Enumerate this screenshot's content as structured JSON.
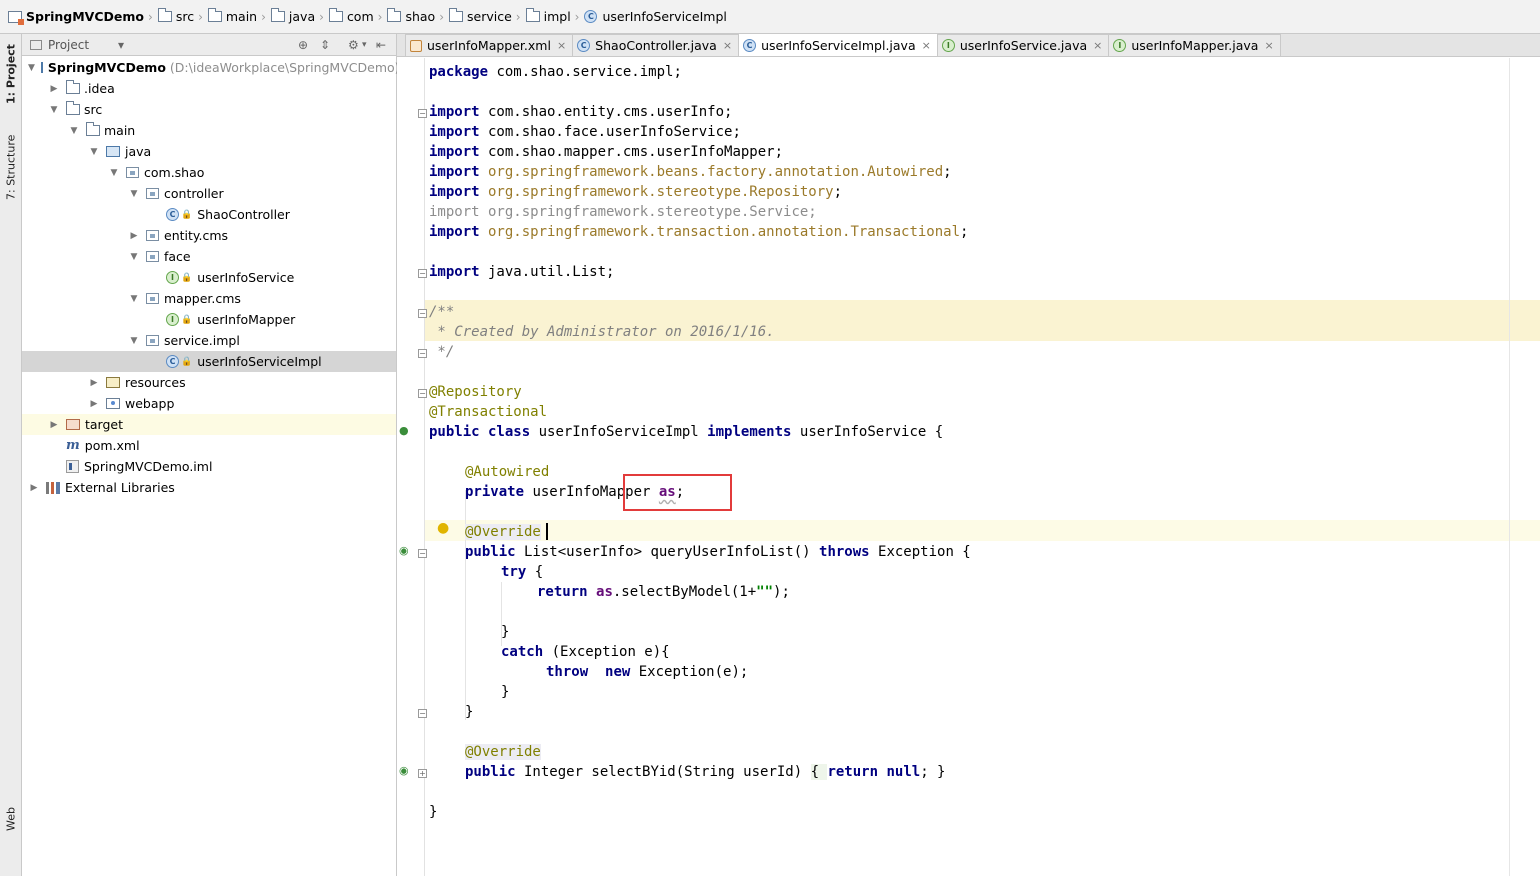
{
  "breadcrumb": [
    "SpringMVCDemo",
    "src",
    "main",
    "java",
    "com",
    "shao",
    "service",
    "impl",
    "userInfoServiceImpl"
  ],
  "left_strip": {
    "project_tab": "1: Project",
    "structure_tab": "7: Structure",
    "web_tab": "Web"
  },
  "project_panel": {
    "title": "Project",
    "tree": [
      {
        "label": "SpringMVCDemo",
        "path": "(D:\\ideaWorkplace\\SpringMVCDemo)",
        "icon": "project-icon",
        "expanded": true
      },
      {
        "label": ".idea",
        "icon": "folder-icon",
        "expanded": false
      },
      {
        "label": "src",
        "icon": "folder-icon",
        "expanded": true
      },
      {
        "label": "main",
        "icon": "folder-icon",
        "expanded": true
      },
      {
        "label": "java",
        "icon": "source-folder-icon",
        "expanded": true
      },
      {
        "label": "com.shao",
        "icon": "package-icon",
        "expanded": true
      },
      {
        "label": "controller",
        "icon": "package-icon",
        "expanded": true
      },
      {
        "label": "ShaoController",
        "icon": "class-icon"
      },
      {
        "label": "entity.cms",
        "icon": "package-icon",
        "expanded": false
      },
      {
        "label": "face",
        "icon": "package-icon",
        "expanded": true
      },
      {
        "label": "userInfoService",
        "icon": "interface-icon"
      },
      {
        "label": "mapper.cms",
        "icon": "package-icon",
        "expanded": true
      },
      {
        "label": "userInfoMapper",
        "icon": "interface-icon"
      },
      {
        "label": "service.impl",
        "icon": "package-icon",
        "expanded": true
      },
      {
        "label": "userInfoServiceImpl",
        "icon": "class-icon",
        "selected": true
      },
      {
        "label": "resources",
        "icon": "resources-folder-icon",
        "expanded": false
      },
      {
        "label": "webapp",
        "icon": "web-folder-icon",
        "expanded": false
      },
      {
        "label": "target",
        "icon": "target-folder-icon",
        "expanded": false
      },
      {
        "label": "pom.xml",
        "icon": "maven-icon"
      },
      {
        "label": "SpringMVCDemo.iml",
        "icon": "iml-icon"
      },
      {
        "label": "External Libraries",
        "icon": "libraries-icon",
        "expanded": false
      }
    ]
  },
  "tabs": [
    {
      "label": "userInfoMapper.xml",
      "icon": "xml-icon",
      "active": false
    },
    {
      "label": "ShaoController.java",
      "icon": "class-icon",
      "active": false
    },
    {
      "label": "userInfoServiceImpl.java",
      "icon": "class-icon",
      "active": true
    },
    {
      "label": "userInfoService.java",
      "icon": "interface-icon",
      "active": false
    },
    {
      "label": "userInfoMapper.java",
      "icon": "interface-icon",
      "active": false
    }
  ],
  "code": {
    "package_kw": "package",
    "package_name": " com.shao.service.impl;",
    "imports": [
      {
        "kw": "import",
        "name": " com.shao.entity.cms.userInfo;",
        "style": "pkg"
      },
      {
        "kw": "import",
        "name": " com.shao.face.userInfoService;",
        "style": "pkg"
      },
      {
        "kw": "import",
        "name": " com.shao.mapper.cms.userInfoMapper;",
        "style": "pkg"
      },
      {
        "kw": "import",
        "name": " org.springframework.beans.factory.annotation.Autowired",
        "style": "lib",
        "tail": ";"
      },
      {
        "kw": "import",
        "name": " org.springframework.stereotype.Repository",
        "style": "lib",
        "tail": ";"
      },
      {
        "kw": "import",
        "name": " org.springframework.stereotype.Service;",
        "style": "grey"
      },
      {
        "kw": "import",
        "name": " org.springframework.transaction.annotation.Transactional",
        "style": "lib",
        "tail": ";"
      }
    ],
    "import_list_kw": "import",
    "import_list": " java.util.List;",
    "comment": [
      "/**",
      " * Created by Administrator on 2016/1/16.",
      " */"
    ],
    "ann_repository": "@Repository",
    "ann_transactional": "@Transactional",
    "class_line": {
      "kw1": "public class",
      "name": " userInfoServiceImpl ",
      "kw2": "implements",
      "iface": " userInfoService {"
    },
    "ann_autowired": "@Autowired",
    "field_line": {
      "kw": "private",
      "type": " userInfoMapper ",
      "name": "as",
      "tail": ";"
    },
    "ann_override1": "@Override",
    "method1": {
      "kw": "public",
      "sig": " List<userInfo> queryUserInfoList() ",
      "kw2": "throws",
      "tail": " Exception {"
    },
    "try_kw": "try",
    "try_tail": " {",
    "return_kw": "return",
    "return_field": "as",
    "return_call": ".selectByModel(1+",
    "return_str": "\"\"",
    "return_tail": ");",
    "close_brace": "}",
    "catch_kw": "catch",
    "catch_tail": " (Exception e){",
    "throw_kw": "throw",
    "new_kw": "new",
    "throw_tail": " Exception(e);",
    "ann_override2": "@Override",
    "method2": {
      "kw": "public",
      "sig": " Integer selectBYid(String userId) ",
      "body_open": "{ ",
      "return_kw": "return",
      "null_kw": "null",
      "body_close": "; }"
    }
  }
}
